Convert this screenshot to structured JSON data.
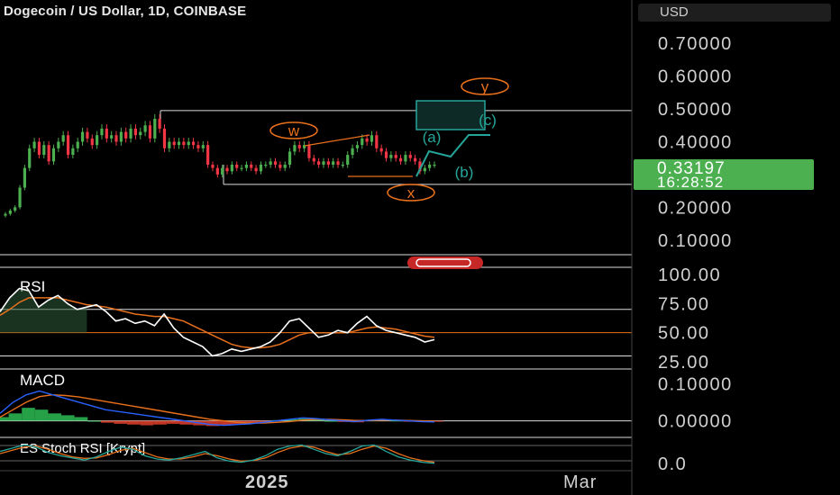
{
  "header": {
    "title": "Dogecoin / US Dollar, 1D, COINBASE",
    "currency": "USD"
  },
  "colors": {
    "up": "#4caf50",
    "down": "#f23645",
    "wave_orange": "#e8701c",
    "wave_teal": "#26a69a",
    "rsi": "#ffffff",
    "rsi_ma": "#e8701c",
    "grid": "#ffffff"
  },
  "price_badge": {
    "price": "0.33197",
    "countdown": "16:28:52"
  },
  "chart_data": [
    {
      "type": "candlestick",
      "title": "Dogecoin / US Dollar, 1D, COINBASE",
      "ylim": [
        0.05,
        0.75
      ],
      "y_ticks": [
        "0.70000",
        "0.60000",
        "0.50000",
        "0.40000",
        "0.20000",
        "0.10000"
      ],
      "y_tick_values": [
        0.7,
        0.6,
        0.5,
        0.4,
        0.2,
        0.1
      ],
      "x_ticks": [
        "2025",
        "Mar"
      ],
      "close": [
        0.18,
        0.19,
        0.2,
        0.26,
        0.32,
        0.38,
        0.4,
        0.36,
        0.39,
        0.34,
        0.38,
        0.4,
        0.42,
        0.36,
        0.38,
        0.4,
        0.43,
        0.41,
        0.39,
        0.42,
        0.44,
        0.41,
        0.42,
        0.4,
        0.43,
        0.41,
        0.44,
        0.42,
        0.43,
        0.45,
        0.41,
        0.47,
        0.44,
        0.38,
        0.4,
        0.39,
        0.4,
        0.39,
        0.4,
        0.39,
        0.38,
        0.39,
        0.33,
        0.32,
        0.3,
        0.32,
        0.31,
        0.33,
        0.32,
        0.32,
        0.33,
        0.32,
        0.31,
        0.33,
        0.33,
        0.34,
        0.33,
        0.32,
        0.33,
        0.37,
        0.39,
        0.38,
        0.39,
        0.35,
        0.34,
        0.33,
        0.34,
        0.33,
        0.34,
        0.33,
        0.33,
        0.36,
        0.38,
        0.39,
        0.41,
        0.4,
        0.42,
        0.38,
        0.37,
        0.35,
        0.36,
        0.35,
        0.34,
        0.36,
        0.35,
        0.34,
        0.31,
        0.32,
        0.33,
        0.33
      ],
      "annotations": [
        {
          "label": "w",
          "color": "orange"
        },
        {
          "label": "x",
          "color": "orange"
        },
        {
          "label": "y",
          "color": "orange"
        },
        {
          "label": "(a)",
          "color": "teal"
        },
        {
          "label": "(b)",
          "color": "teal"
        },
        {
          "label": "(c)",
          "color": "teal"
        }
      ]
    },
    {
      "type": "line",
      "title": "RSI",
      "ylim": [
        25,
        100
      ],
      "y_ticks": [
        "100.00",
        "75.00",
        "50.00",
        "25.00"
      ],
      "y_tick_values": [
        100,
        75,
        50,
        25
      ],
      "bands": [
        70,
        50,
        30
      ],
      "series": [
        {
          "values": [
            68,
            80,
            88,
            86,
            72,
            78,
            82,
            75,
            70,
            72,
            74,
            68,
            60,
            62,
            58,
            60,
            56,
            66,
            54,
            46,
            42,
            38,
            30,
            32,
            36,
            34,
            36,
            38,
            42,
            50,
            60,
            62,
            54,
            46,
            48,
            52,
            50,
            58,
            64,
            56,
            52,
            50,
            48,
            46,
            42,
            44
          ]
        },
        {
          "values": [
            65,
            70,
            76,
            80,
            80,
            80,
            80,
            78,
            76,
            74,
            73,
            72,
            70,
            68,
            66,
            65,
            64,
            64,
            62,
            60,
            56,
            52,
            48,
            44,
            40,
            38,
            37,
            37,
            38,
            40,
            44,
            48,
            50,
            50,
            50,
            50,
            50,
            52,
            54,
            55,
            54,
            53,
            51,
            49,
            47,
            46
          ]
        }
      ]
    },
    {
      "type": "bar",
      "title": "MACD",
      "ylim": [
        -0.03,
        0.12
      ],
      "y_ticks": [
        "0.10000",
        "0.00000"
      ],
      "y_tick_values": [
        0.1,
        0.0
      ],
      "histogram": [
        0.01,
        0.02,
        0.035,
        0.03,
        0.02,
        0.015,
        0.01,
        0.0,
        -0.005,
        -0.008,
        -0.01,
        -0.012,
        -0.01,
        -0.008,
        -0.01,
        -0.012,
        -0.014,
        -0.012,
        -0.01,
        -0.006,
        -0.004,
        0.002,
        0.004,
        0.006,
        0.003,
        0.0,
        -0.003,
        -0.004,
        0.002,
        0.003,
        0.001,
        -0.002,
        -0.003,
        -0.002
      ],
      "series": [
        {
          "values": [
            0.02,
            0.05,
            0.07,
            0.08,
            0.07,
            0.06,
            0.05,
            0.04,
            0.03,
            0.025,
            0.02,
            0.015,
            0.01,
            0.005,
            0.0,
            -0.005,
            -0.01,
            -0.012,
            -0.01,
            -0.008,
            -0.004,
            0.0,
            0.004,
            0.008,
            0.006,
            0.003,
            0.0,
            -0.002,
            0.002,
            0.004,
            0.002,
            0.0,
            -0.002,
            -0.003
          ]
        },
        {
          "values": [
            0.01,
            0.03,
            0.05,
            0.065,
            0.07,
            0.068,
            0.064,
            0.058,
            0.052,
            0.046,
            0.04,
            0.034,
            0.028,
            0.022,
            0.016,
            0.01,
            0.004,
            0.0,
            -0.004,
            -0.006,
            -0.006,
            -0.004,
            -0.002,
            0.002,
            0.004,
            0.004,
            0.003,
            0.001,
            0.001,
            0.002,
            0.002,
            0.001,
            0.0,
            -0.001
          ]
        }
      ]
    },
    {
      "type": "line",
      "title": "ES Stoch RSI [Krypt]",
      "ylim": [
        0,
        100
      ],
      "y_ticks": [
        "0.0"
      ],
      "y_tick_values": [
        0
      ],
      "series": [
        {
          "values": [
            60,
            75,
            90,
            80,
            55,
            40,
            30,
            20,
            35,
            60,
            80,
            70,
            40,
            25,
            20,
            30,
            45,
            60,
            30,
            15,
            10,
            20,
            40,
            70,
            85,
            90,
            70,
            50,
            40,
            60,
            85,
            90,
            60,
            35,
            20,
            10,
            5
          ]
        },
        {
          "values": [
            50,
            65,
            80,
            85,
            70,
            50,
            35,
            28,
            30,
            45,
            65,
            75,
            55,
            35,
            25,
            25,
            35,
            50,
            40,
            25,
            15,
            18,
            30,
            55,
            75,
            85,
            80,
            60,
            45,
            50,
            70,
            85,
            75,
            50,
            30,
            18,
            10
          ]
        }
      ]
    }
  ]
}
